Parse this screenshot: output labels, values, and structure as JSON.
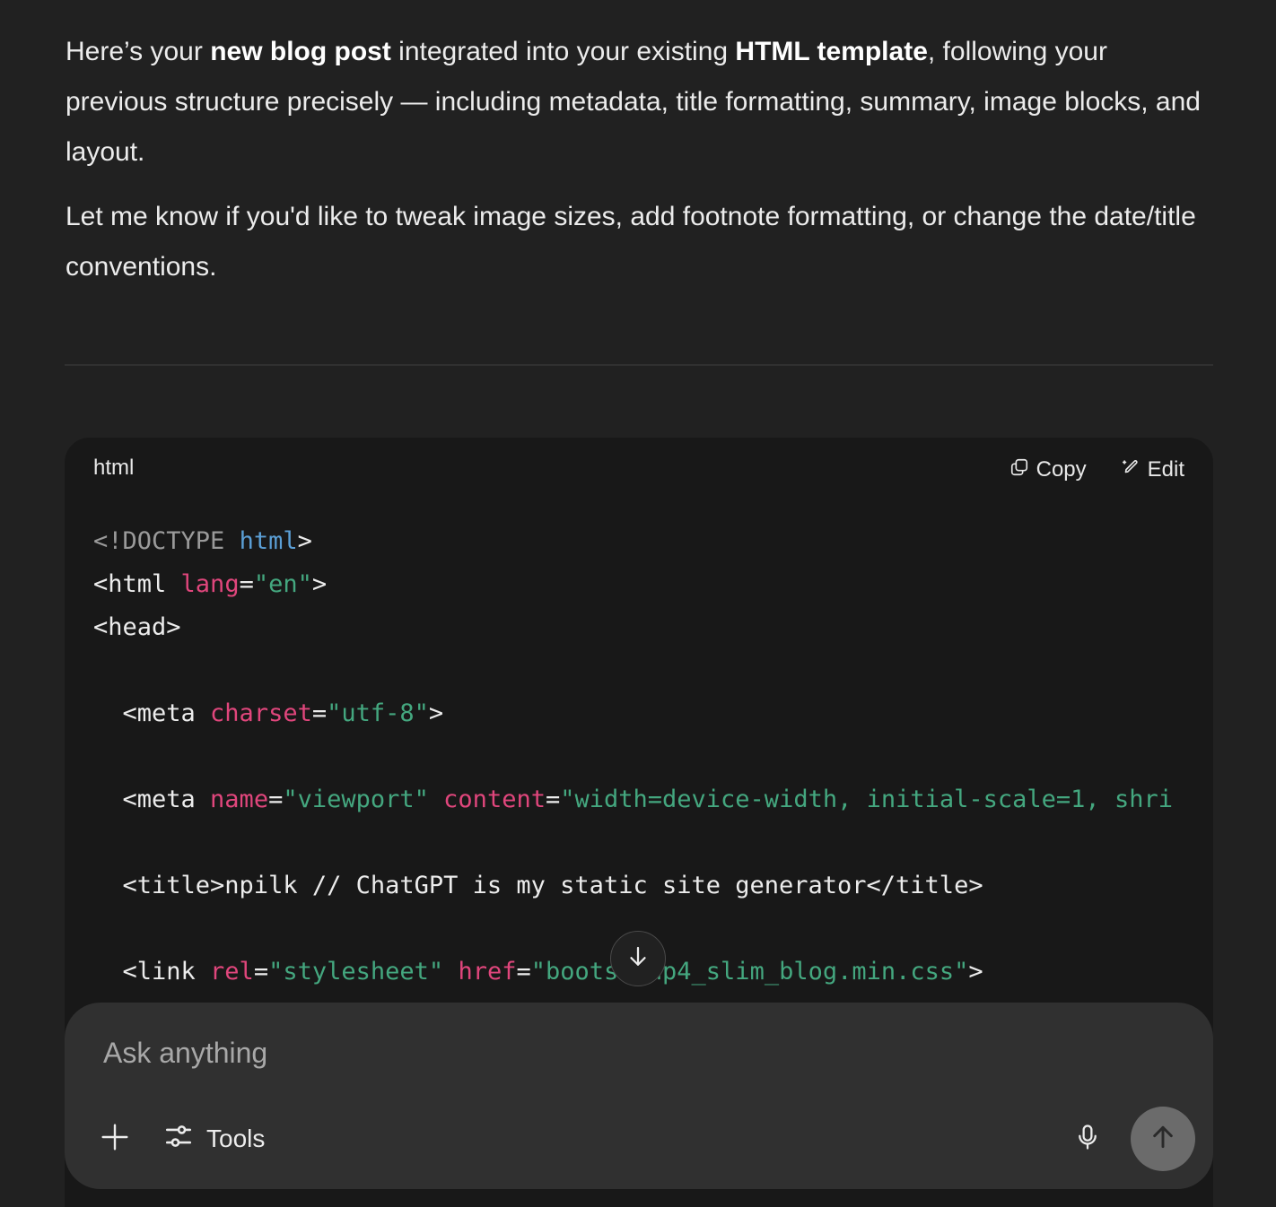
{
  "message": {
    "paragraph1": {
      "part1": "Here’s your ",
      "bold1": "new blog post",
      "part2": " integrated into your existing ",
      "bold2": "HTML template",
      "part3": ", following your previous structure precisely — including metadata, title formatting, summary, image blocks, and layout."
    },
    "paragraph2": "Let me know if you'd like to tweak image sizes, add footnote formatting, or change the date/title conventions."
  },
  "code_block": {
    "language": "html",
    "copy_label": "Copy",
    "edit_label": "Edit",
    "lines": [
      [
        {
          "t": "<!DOCTYPE ",
          "c": "doctype"
        },
        {
          "t": "html",
          "c": "tag-blue"
        },
        {
          "t": ">",
          "c": "plain"
        }
      ],
      [
        {
          "t": "<html ",
          "c": "plain"
        },
        {
          "t": "lang",
          "c": "attr"
        },
        {
          "t": "=",
          "c": "plain"
        },
        {
          "t": "\"en\"",
          "c": "str"
        },
        {
          "t": ">",
          "c": "plain"
        }
      ],
      [
        {
          "t": "<head>",
          "c": "plain"
        }
      ],
      [],
      [
        {
          "t": "  <meta ",
          "c": "plain"
        },
        {
          "t": "charset",
          "c": "attr"
        },
        {
          "t": "=",
          "c": "plain"
        },
        {
          "t": "\"utf-8\"",
          "c": "str"
        },
        {
          "t": ">",
          "c": "plain"
        }
      ],
      [],
      [
        {
          "t": "  <meta ",
          "c": "plain"
        },
        {
          "t": "name",
          "c": "attr"
        },
        {
          "t": "=",
          "c": "plain"
        },
        {
          "t": "\"viewport\"",
          "c": "str"
        },
        {
          "t": " ",
          "c": "plain"
        },
        {
          "t": "content",
          "c": "attr"
        },
        {
          "t": "=",
          "c": "plain"
        },
        {
          "t": "\"width=device-width, initial-scale=1, shri",
          "c": "str"
        }
      ],
      [],
      [
        {
          "t": "  <title>npilk // ChatGPT is my static site generator</title>",
          "c": "plain"
        }
      ],
      [],
      [
        {
          "t": "  <link ",
          "c": "plain"
        },
        {
          "t": "rel",
          "c": "attr"
        },
        {
          "t": "=",
          "c": "plain"
        },
        {
          "t": "\"stylesheet\"",
          "c": "str"
        },
        {
          "t": " ",
          "c": "plain"
        },
        {
          "t": "href",
          "c": "attr"
        },
        {
          "t": "=",
          "c": "plain"
        },
        {
          "t": "\"bootstrap4_slim_blog.min.css\"",
          "c": "str"
        },
        {
          "t": ">",
          "c": "plain"
        }
      ]
    ]
  },
  "composer": {
    "placeholder": "Ask anything",
    "tools_label": "Tools"
  },
  "icons": {
    "copy": "copy-icon",
    "edit": "edit-icon",
    "scroll_down": "arrow-down-icon",
    "plus": "plus-icon",
    "tools": "sliders-icon",
    "mic": "microphone-icon",
    "send": "arrow-up-icon"
  },
  "colors": {
    "background": "#212121",
    "code_background": "#181818",
    "composer_background": "#303030",
    "attr": "#e0467c",
    "string": "#44a77f",
    "tag_keyword": "#5b9fd6",
    "send_button": "#6b6b6b"
  }
}
